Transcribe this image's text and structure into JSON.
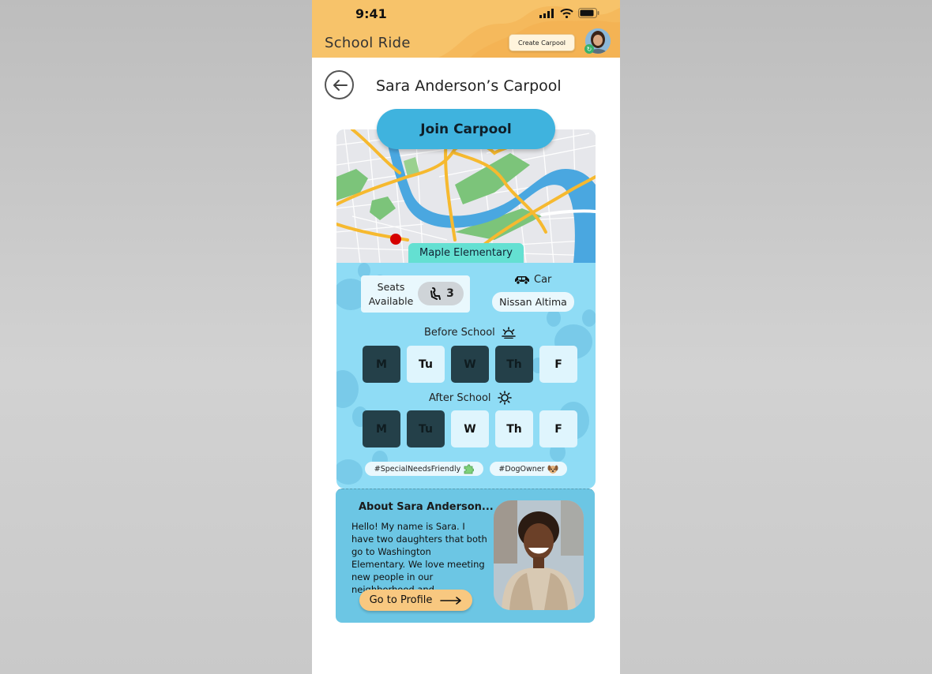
{
  "status": {
    "time": "9:41"
  },
  "header": {
    "app_title": "School Ride",
    "create_button": "Create Carpool",
    "avatar_badge": "↻"
  },
  "page": {
    "title": "Sara Anderson’s Carpool"
  },
  "join_button": "Join Carpool",
  "map": {
    "school_name": "Maple Elementary"
  },
  "details": {
    "seats_label": "Seats Available",
    "seats_count": "3",
    "car_label": "Car",
    "car_model": "Nissan Altima"
  },
  "before_school": {
    "label": "Before School",
    "days": [
      {
        "label": "M",
        "active": true
      },
      {
        "label": "Tu",
        "active": false
      },
      {
        "label": "W",
        "active": true
      },
      {
        "label": "Th",
        "active": true
      },
      {
        "label": "F",
        "active": false
      }
    ]
  },
  "after_school": {
    "label": "After School",
    "days": [
      {
        "label": "M",
        "active": true
      },
      {
        "label": "Tu",
        "active": true
      },
      {
        "label": "W",
        "active": false
      },
      {
        "label": "Th",
        "active": false
      },
      {
        "label": "F",
        "active": false
      }
    ]
  },
  "tags": [
    {
      "label": "#SpecialNeedsFriendly",
      "icon": "puzzle-icon"
    },
    {
      "label": "#DogOwner",
      "icon": "dog-icon"
    }
  ],
  "about": {
    "title": "About Sara Anderson...",
    "text": "Hello! My name is Sara. I have two daughters that both go to Washington Elementary. We love meeting new people in our neighborhood and...",
    "profile_button": "Go to Profile"
  },
  "colors": {
    "header": "#f7c36a",
    "card": "#8fdcf5",
    "join": "#3fb3de",
    "day_active": "#244049",
    "day_inactive": "#dff5fd",
    "school_chip": "#64e0d2",
    "profile_button": "#f8c880"
  }
}
